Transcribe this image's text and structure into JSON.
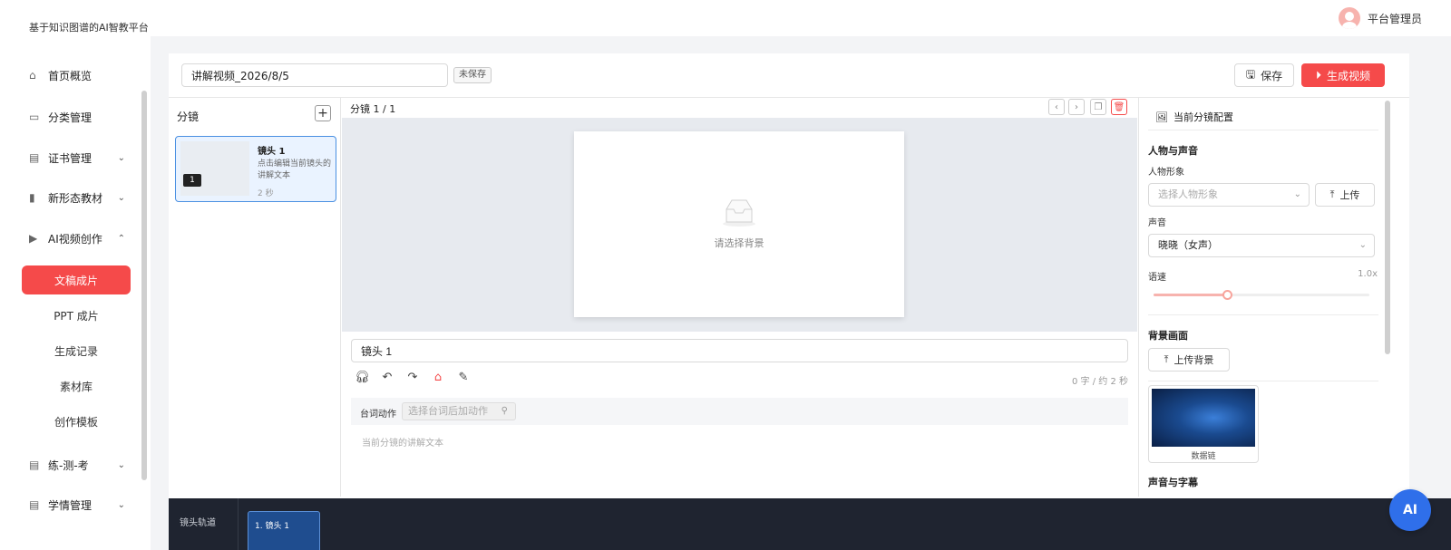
{
  "app": {
    "title": "基于知识图谱的AI智教平台"
  },
  "user": {
    "name": "平台管理员"
  },
  "sidebar": {
    "items": [
      {
        "label": "首页概览",
        "icon": "home-icon"
      },
      {
        "label": "分类管理",
        "icon": "folder-icon"
      },
      {
        "label": "证书管理",
        "icon": "certificate-icon",
        "expandable": true
      },
      {
        "label": "新形态教材",
        "icon": "book-icon",
        "expandable": true
      },
      {
        "label": "AI视频创作",
        "icon": "video-icon",
        "expanded": true
      },
      {
        "label": "练-测-考",
        "icon": "exam-icon",
        "expandable": true
      },
      {
        "label": "学情管理",
        "icon": "analytics-icon",
        "expandable": true
      }
    ],
    "sub_items": [
      {
        "label": "文稿成片",
        "active": true
      },
      {
        "label": "PPT 成片"
      },
      {
        "label": "生成记录"
      },
      {
        "label": "素材库"
      },
      {
        "label": "创作模板"
      }
    ]
  },
  "editor": {
    "title_value": "讲解视频_2026/8/5",
    "status_badge": "未保存",
    "save_label": "保存",
    "generate_label": "生成视频"
  },
  "shots": {
    "title": "分镜",
    "items": [
      {
        "number": "1",
        "name": "镜头 1",
        "desc": "点击编辑当前镜头的讲解文本",
        "duration": "2 秒"
      }
    ]
  },
  "center": {
    "title": "分镜 1 / 1",
    "canvas_hint": "请选择背景",
    "shot_title_value": "镜头 1",
    "counter": "0 字 / 约 2 秒",
    "action_label": "台词动作",
    "action_placeholder": "选择台词后加动作",
    "narration_placeholder": "当前分镜的讲解文本"
  },
  "config": {
    "title": "当前分镜配置",
    "section_person": "人物与声音",
    "avatar_label": "人物形象",
    "avatar_placeholder": "选择人物形象",
    "upload_label": "上传",
    "voice_label": "声音",
    "voice_value": "晓晓（女声）",
    "speed_label": "语速",
    "speed_value": "1.0x",
    "speed_fraction": 0.34,
    "section_background": "背景画面",
    "upload_bg_label": "上传背景",
    "bg_name": "数据链",
    "section_audio": "声音与字幕"
  },
  "timeline": {
    "label": "镜头轨道",
    "clips": [
      {
        "name": "1. 镜头 1"
      }
    ]
  },
  "fab": {
    "label": "AI"
  },
  "colors": {
    "accent": "#f54a4a",
    "primary": "#2f6fea",
    "timeline_bg": "#1f2430"
  }
}
